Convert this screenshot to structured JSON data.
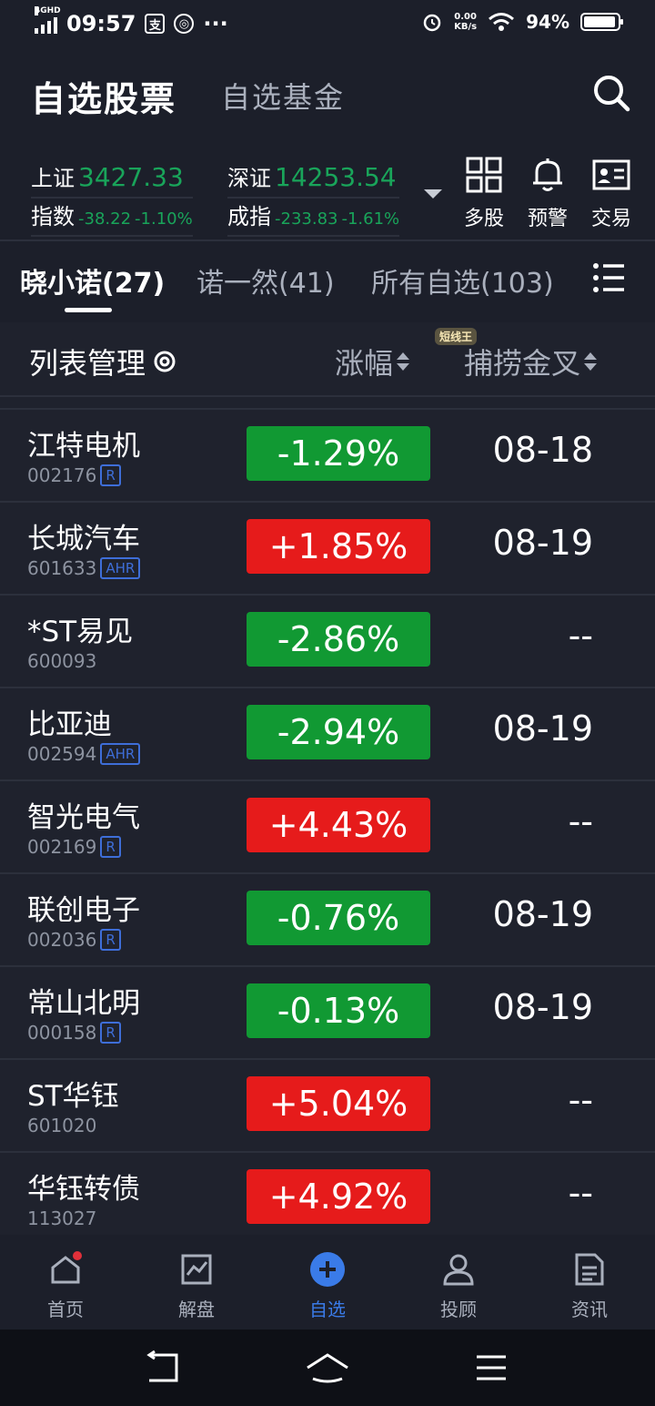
{
  "status": {
    "network": "4GHD",
    "time": "09:57",
    "speed_value": "0.00",
    "speed_unit": "KB/s",
    "battery": "94%",
    "battery_level": 0.94
  },
  "header": {
    "title": "自选股票",
    "subtitle": "自选基金"
  },
  "indices": [
    {
      "name1": "上证",
      "name2": "指数",
      "value": "3427.33",
      "change": "-38.22",
      "percent": "-1.10%"
    },
    {
      "name1": "深证",
      "name2": "成指",
      "value": "14253.54",
      "change": "-233.83",
      "percent": "-1.61%"
    }
  ],
  "tools": [
    {
      "label": "多股",
      "icon": "grid-icon"
    },
    {
      "label": "预警",
      "icon": "bell-icon"
    },
    {
      "label": "交易",
      "icon": "id-card-icon"
    }
  ],
  "tabs": [
    {
      "label": "晓小诺(27)",
      "active": true
    },
    {
      "label": "诺一然(41)",
      "active": false
    },
    {
      "label": "所有自选(103)",
      "active": false
    }
  ],
  "list_header": {
    "manage": "列表管理",
    "change_col": "涨幅",
    "golden_col": "捕捞金叉",
    "badge": "短线王"
  },
  "stocks": [
    {
      "name": "江特电机",
      "code": "002176",
      "tag": "R",
      "change": "-1.29%",
      "dir": "down",
      "date": "08-18"
    },
    {
      "name": "长城汽车",
      "code": "601633",
      "tag": "AHR",
      "change": "+1.85%",
      "dir": "up",
      "date": "08-19"
    },
    {
      "name": "*ST易见",
      "code": "600093",
      "tag": "",
      "change": "-2.86%",
      "dir": "down",
      "date": "--"
    },
    {
      "name": "比亚迪",
      "code": "002594",
      "tag": "AHR",
      "change": "-2.94%",
      "dir": "down",
      "date": "08-19"
    },
    {
      "name": "智光电气",
      "code": "002169",
      "tag": "R",
      "change": "+4.43%",
      "dir": "up",
      "date": "--"
    },
    {
      "name": "联创电子",
      "code": "002036",
      "tag": "R",
      "change": "-0.76%",
      "dir": "down",
      "date": "08-19"
    },
    {
      "name": "常山北明",
      "code": "000158",
      "tag": "R",
      "change": "-0.13%",
      "dir": "down",
      "date": "08-19"
    },
    {
      "name": "ST华钰",
      "code": "601020",
      "tag": "",
      "change": "+5.04%",
      "dir": "up",
      "date": "--"
    },
    {
      "name": "华钰转债",
      "code": "113027",
      "tag": "",
      "change": "+4.92%",
      "dir": "up",
      "date": "--"
    }
  ],
  "bottom_nav": [
    {
      "label": "首页",
      "icon": "home-icon",
      "active": false,
      "dot": true
    },
    {
      "label": "解盘",
      "icon": "chart-icon",
      "active": false,
      "dot": false
    },
    {
      "label": "自选",
      "icon": "plus-circle-icon",
      "active": true,
      "dot": false
    },
    {
      "label": "投顾",
      "icon": "person-icon",
      "active": false,
      "dot": false
    },
    {
      "label": "资讯",
      "icon": "document-icon",
      "active": false,
      "dot": false
    }
  ],
  "colors": {
    "up": "#e61b1b",
    "down": "#119933",
    "index_green": "#19a45a",
    "accent": "#3a7be8",
    "background": "#1c1f2a"
  }
}
